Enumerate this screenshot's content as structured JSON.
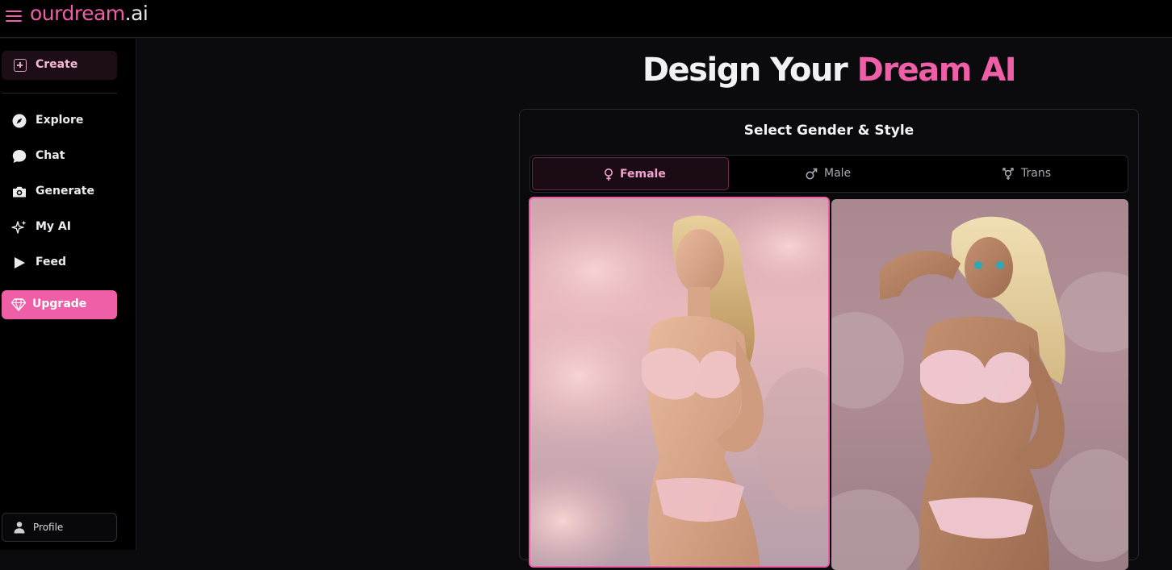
{
  "topbar": {
    "logo_brand": "ourdream",
    "logo_tld": ".ai",
    "menu_icon": "hamburger-menu-icon"
  },
  "sidebar": {
    "create": {
      "label": "Create",
      "icon": "plus-square-icon"
    },
    "items": [
      {
        "label": "Explore",
        "icon": "compass-icon"
      },
      {
        "label": "Chat",
        "icon": "chat-bubble-icon"
      },
      {
        "label": "Generate",
        "icon": "camera-icon"
      },
      {
        "label": "My AI",
        "icon": "sparkle-icon"
      },
      {
        "label": "Feed",
        "icon": "play-icon"
      }
    ],
    "upgrade": {
      "label": "Upgrade",
      "icon": "diamond-icon"
    },
    "profile": {
      "label": "Profile",
      "icon": "user-icon"
    }
  },
  "main": {
    "title_part1": "Design Your",
    "title_part2": "Dream AI",
    "panel_title": "Select Gender & Style",
    "gender_tabs": [
      {
        "label": "Female",
        "icon": "female-symbol-icon",
        "active": true
      },
      {
        "label": "Male",
        "icon": "male-symbol-icon",
        "active": false
      },
      {
        "label": "Trans",
        "icon": "transgender-symbol-icon",
        "active": false
      }
    ],
    "style_cards": [
      {
        "style": "realistic",
        "selected": true
      },
      {
        "style": "anime",
        "selected": false
      }
    ]
  },
  "colors": {
    "accent": "#ef5fa7",
    "background": "#0b0a0d",
    "sidebar": "#000000"
  }
}
